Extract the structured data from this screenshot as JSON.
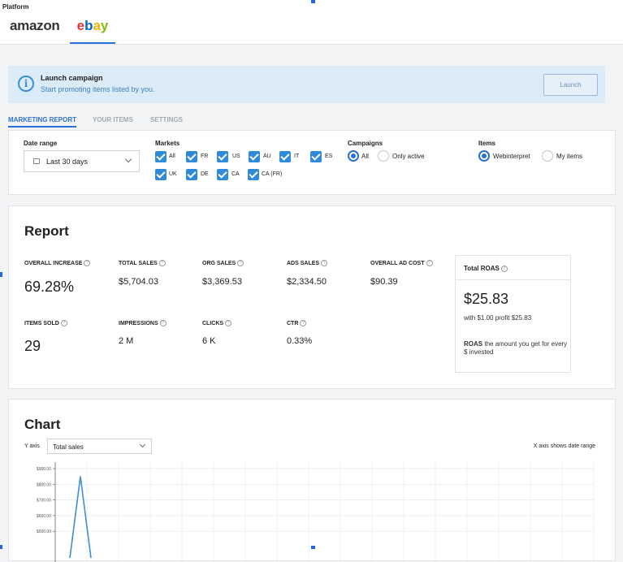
{
  "platform": {
    "label": "Platform",
    "tabs": [
      {
        "name": "amazon",
        "label": "amazon",
        "active": false
      },
      {
        "name": "ebay",
        "label": "ebay",
        "active": true
      }
    ]
  },
  "banner": {
    "title": "Launch campaign",
    "subtitle": "Start promoting items listed by you.",
    "button": "Launch"
  },
  "tabs": [
    "MARKETING REPORT",
    "YOUR ITEMS",
    "SETTINGS"
  ],
  "filters": {
    "date_range": {
      "label": "Date range",
      "value": "Last 30 days"
    },
    "markets": {
      "label": "Markets",
      "options": [
        "All",
        "FR",
        "US",
        "AU",
        "IT",
        "ES",
        "UK",
        "DE",
        "CA",
        "CA (FR)"
      ]
    },
    "campaigns": {
      "label": "Campaigns",
      "options": [
        "All",
        "Only active"
      ],
      "selected": "All"
    },
    "items": {
      "label": "Items",
      "options": [
        "Webinterpret",
        "My items"
      ],
      "selected": "Webinterpret"
    }
  },
  "report": {
    "title": "Report",
    "metrics": [
      {
        "label": "OVERALL INCREASE",
        "value": "69.28%"
      },
      {
        "label": "TOTAL SALES",
        "value": "$5,704.03"
      },
      {
        "label": "ORG SALES",
        "value": "$3,369.53"
      },
      {
        "label": "ADS SALES",
        "value": "$2,334.50"
      },
      {
        "label": "OVERALL AD COST",
        "value": "$90.39"
      },
      {
        "label": "ITEMS SOLD",
        "value": "29"
      },
      {
        "label": "IMPRESSIONS",
        "value": "2 M"
      },
      {
        "label": "CLICKS",
        "value": "6 K"
      },
      {
        "label": "CTR",
        "value": "0.33%"
      }
    ],
    "roas": {
      "title": "Total ROAS",
      "value": "$25.83",
      "subtitle": "with $1.00 profit $25.83",
      "note_bold": "ROAS",
      "note": " the amount you get for every $ invested"
    }
  },
  "chart": {
    "title": "Chart",
    "y_axis_label": "Y axis",
    "y_axis_value": "Total sales",
    "x_axis_note": "X axis shows date range"
  },
  "chart_data": {
    "type": "line",
    "title": "",
    "xlabel": "",
    "ylabel": "",
    "yticks": [
      "$900.00",
      "$800.00",
      "$700.00",
      "$600.00",
      "$500.00"
    ],
    "ylim": [
      500,
      900
    ],
    "series": [
      {
        "values": [
          330,
          850,
          330
        ]
      }
    ],
    "grid": true,
    "color": "#3b8fd9"
  },
  "colors": {
    "accent": "#2a6fdb",
    "banner_bg": "#dcebf8",
    "checkbox": "#2f8ad9"
  }
}
